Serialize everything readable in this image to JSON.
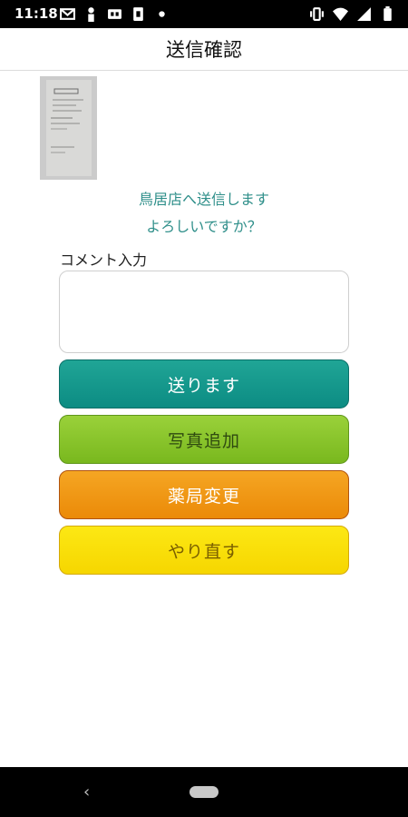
{
  "status_bar": {
    "time": "11:18",
    "left_icons": [
      "gmail-icon",
      "person-icon",
      "cc-icon",
      "storage-icon",
      "dot-icon"
    ],
    "right_icons": [
      "vibrate-icon",
      "wifi-icon",
      "signal-icon",
      "battery-icon"
    ]
  },
  "header": {
    "title": "送信確認"
  },
  "photo": {
    "icon": "receipt-photo-thumbnail"
  },
  "message": {
    "line1": "鳥居店へ送信します",
    "line2": "よろしいですか？"
  },
  "comment": {
    "label": "コメント入力",
    "value": "",
    "placeholder": ""
  },
  "buttons": {
    "send": "送ります",
    "add_photo": "写真追加",
    "change_pharmacy": "薬局変更",
    "redo": "やり直す"
  },
  "colors": {
    "accent_text": "#2f8f8a",
    "send": "#12998c",
    "add_photo": "#86c226",
    "change_pharmacy": "#ef9410",
    "redo": "#fadf0a"
  }
}
